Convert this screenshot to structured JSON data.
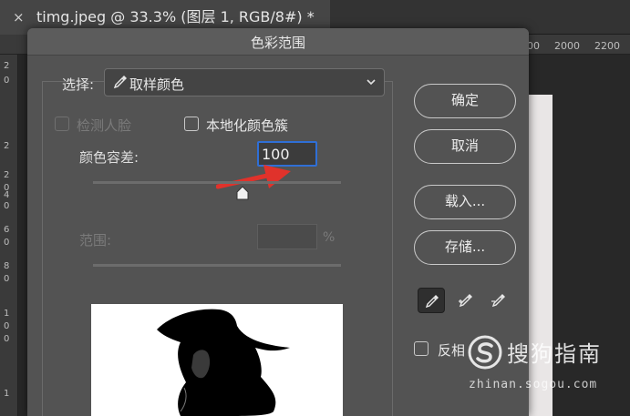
{
  "document_tab": {
    "close_glyph": "×",
    "title": "timg.jpeg @ 33.3% (图层 1, RGB/8#) *"
  },
  "ruler_top": {
    "labels": [
      "00",
      "2000",
      "2200"
    ]
  },
  "ruler_left": {
    "labels": [
      "2",
      "0",
      "2",
      "2",
      "0",
      "4",
      "0",
      "6",
      "0",
      "8",
      "0",
      "1",
      "0",
      "0",
      "1"
    ]
  },
  "dialog": {
    "title": "色彩范围",
    "select": {
      "label": "选择:",
      "value": "取样颜色",
      "icon": "eyedropper-icon"
    },
    "detect_faces": {
      "label": "检测人脸",
      "checked": false,
      "enabled": false
    },
    "localized_clusters": {
      "label": "本地化颜色簇",
      "checked": false,
      "enabled": true
    },
    "fuzziness": {
      "label": "颜色容差:",
      "value": "100",
      "slider_fraction": 0.5
    },
    "range": {
      "label": "范围:",
      "value": "",
      "unit": "%"
    },
    "buttons": {
      "ok": "确定",
      "cancel": "取消",
      "load": "载入...",
      "save": "存储..."
    },
    "eyedroppers": [
      {
        "name": "eyedropper-icon",
        "active": true
      },
      {
        "name": "eyedropper-plus-icon",
        "active": false
      },
      {
        "name": "eyedropper-minus-icon",
        "active": false
      }
    ],
    "invert": {
      "label": "反相",
      "checked": false
    }
  },
  "watermark": {
    "brand": "搜狗指南",
    "url": "zhinan.sogou.com"
  },
  "colors": {
    "dialog_bg": "#535353",
    "focus_blue": "#2f6fd6",
    "arrow_red": "#e0322b"
  }
}
